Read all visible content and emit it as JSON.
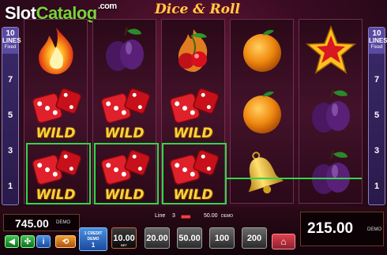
{
  "watermark": {
    "part1": "Slot",
    "part2": "Catalog",
    "part3": ".com"
  },
  "game_logo": "Dice & Roll",
  "reels": [
    {
      "symbols": [
        "fire-icon",
        "wild-dice-icon",
        "wild-dice-icon"
      ],
      "wild_labels": [
        "",
        "WILD",
        "WILD"
      ]
    },
    {
      "symbols": [
        "plum-icon",
        "wild-dice-icon",
        "wild-dice-icon"
      ],
      "wild_labels": [
        "",
        "WILD",
        "WILD"
      ]
    },
    {
      "symbols": [
        "cherry-fire-icon",
        "wild-dice-icon",
        "wild-dice-icon"
      ],
      "wild_labels": [
        "",
        "WILD",
        "WILD"
      ]
    },
    {
      "symbols": [
        "orange-icon",
        "orange-icon",
        "bell-icon"
      ],
      "wild_labels": [
        "",
        "",
        ""
      ]
    },
    {
      "symbols": [
        "star-icon",
        "plum-icon",
        "plum-icon"
      ],
      "wild_labels": [
        "",
        "",
        ""
      ]
    }
  ],
  "lines_panel": {
    "count": "10",
    "label": "LINES",
    "mode": "Fixed",
    "numbers": [
      "7",
      "5",
      "3",
      "1"
    ]
  },
  "balance": {
    "value": "745.00",
    "currency": "DEMO"
  },
  "line_info": {
    "line_label": "Line",
    "line_number": "3",
    "win_value": "50.00",
    "currency": "DEMO"
  },
  "win": {
    "value": "215.00",
    "currency": "DEMO"
  },
  "credit_button": {
    "line1": "1 CREDIT",
    "line2": "DEMO",
    "value": "1"
  },
  "bet_buttons": [
    {
      "label": "10.00",
      "selected": true,
      "caption": "BET"
    },
    {
      "label": "20.00",
      "selected": false
    },
    {
      "label": "50.00",
      "selected": false
    },
    {
      "label": "100",
      "selected": false
    },
    {
      "label": "200",
      "selected": false
    }
  ],
  "colors": {
    "highlight": "#30d64a",
    "gold": "#ffd23a",
    "panel": "#0c0205"
  }
}
